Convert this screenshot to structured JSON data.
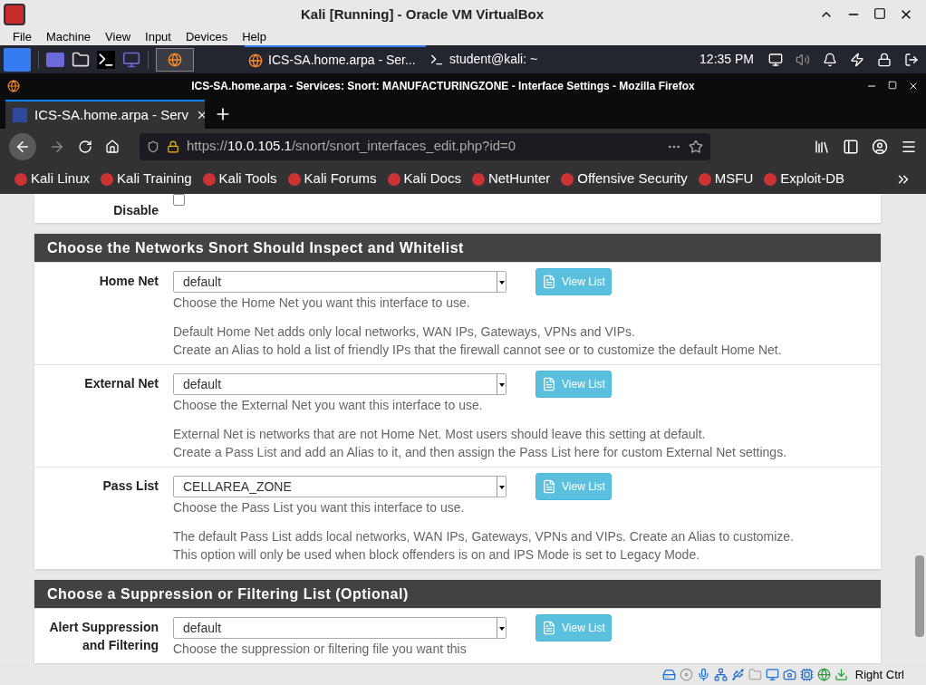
{
  "vm_window": {
    "title": "Kali [Running] - Oracle VM VirtualBox",
    "menu": [
      "File",
      "Machine",
      "View",
      "Input",
      "Devices",
      "Help"
    ],
    "host_key": "Right Ctrl"
  },
  "taskbar": {
    "tasks": [
      {
        "label": "ICS-SA.home.arpa - Ser...",
        "selected": true
      },
      {
        "label": "student@kali: ~",
        "selected": false
      }
    ],
    "clock": "12:35 PM"
  },
  "browser": {
    "title": "ICS-SA.home.arpa - Services: Snort: MANUFACTURINGZONE - Interface Settings - Mozilla Firefox",
    "tab": "ICS-SA.home.arpa - Serv",
    "url_prefix": "https://",
    "url_host": "10.0.105.1",
    "url_path": "/snort/snort_interfaces_edit.php?id=0",
    "bookmarks": [
      "Kali Linux",
      "Kali Training",
      "Kali Tools",
      "Kali Forums",
      "Kali Docs",
      "NetHunter",
      "Offensive Security",
      "MSFU",
      "Exploit-DB"
    ]
  },
  "page": {
    "partial_row": {
      "label": "Disable",
      "checked": false
    },
    "sections": [
      {
        "title": "Choose the Networks Snort Should Inspect and Whitelist",
        "rows": [
          {
            "label": "Home Net",
            "value": "default",
            "button": "View List",
            "help": "Choose the Home Net you want this interface to use.",
            "notes": [
              "Default Home Net adds only local networks, WAN IPs, Gateways, VPNs and VIPs.",
              "Create an Alias to hold a list of friendly IPs that the firewall cannot see or to customize the default Home Net."
            ]
          },
          {
            "label": "External Net",
            "value": "default",
            "button": "View List",
            "help": "Choose the External Net you want this interface to use.",
            "notes": [
              "External Net is networks that are not Home Net. Most users should leave this setting at default.",
              "Create a Pass List and add an Alias to it, and then assign the Pass List here for custom External Net settings."
            ]
          },
          {
            "label": "Pass List",
            "value": "CELLAREA_ZONE",
            "button": "View List",
            "help": "Choose the Pass List you want this interface to use.",
            "notes": [
              "The default Pass List adds local networks, WAN IPs, Gateways, VPNs and VIPs. Create an Alias to customize.",
              "This option will only be used when block offenders is on and IPS Mode is set to Legacy Mode."
            ]
          }
        ]
      },
      {
        "title": "Choose a Suppression or Filtering List (Optional)",
        "rows": [
          {
            "label": "Alert Suppression and Filtering",
            "value": "default",
            "button": "View List",
            "help": "Choose the suppression or filtering file you want this",
            "notes": []
          }
        ]
      }
    ]
  }
}
